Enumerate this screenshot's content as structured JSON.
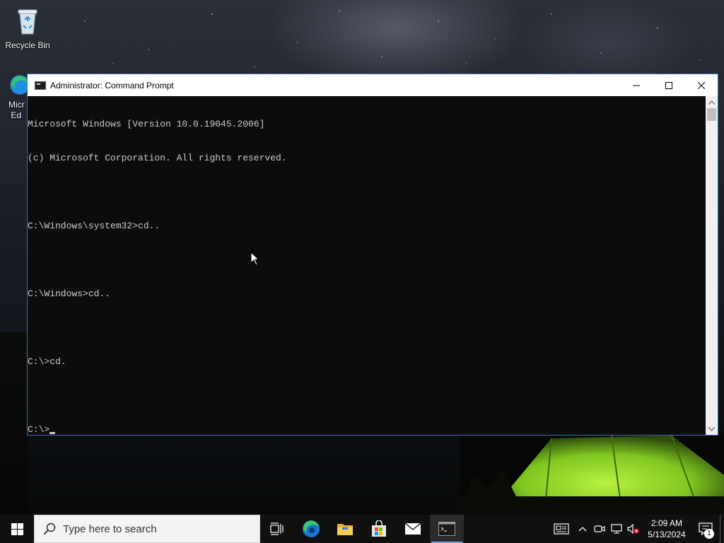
{
  "desktop": {
    "icons": [
      {
        "label": "Recycle Bin",
        "icon": "recycle-bin-icon"
      },
      {
        "label": "Micr\nEd",
        "icon": "edge-icon"
      }
    ]
  },
  "window": {
    "title": "Administrator: Command Prompt",
    "icon": "cmd-icon",
    "controls": {
      "minimize": "─",
      "maximize": "☐",
      "close": "✕"
    },
    "console_lines": [
      "Microsoft Windows [Version 10.0.19045.2006]",
      "(c) Microsoft Corporation. All rights reserved.",
      "",
      "C:\\Windows\\system32>cd..",
      "",
      "C:\\Windows>cd..",
      "",
      "C:\\>cd.",
      "",
      "C:\\>"
    ],
    "colors": {
      "console_bg": "#0c0c0c",
      "console_text": "#cccccc"
    }
  },
  "taskbar": {
    "search_placeholder": "Type here to search",
    "apps": [
      {
        "name": "task-view",
        "icon": "task-view-icon"
      },
      {
        "name": "edge",
        "icon": "edge-icon"
      },
      {
        "name": "file-explorer",
        "icon": "folder-icon"
      },
      {
        "name": "microsoft-store",
        "icon": "store-icon"
      },
      {
        "name": "mail",
        "icon": "mail-icon"
      },
      {
        "name": "command-prompt",
        "icon": "cmd-icon",
        "active": true
      }
    ],
    "tray": {
      "time": "2:09 AM",
      "date": "5/13/2024",
      "notification_count": "1",
      "icons": [
        "news-icon",
        "chevron-up-icon",
        "meet-now-icon",
        "network-icon",
        "volume-muted-icon"
      ]
    }
  }
}
